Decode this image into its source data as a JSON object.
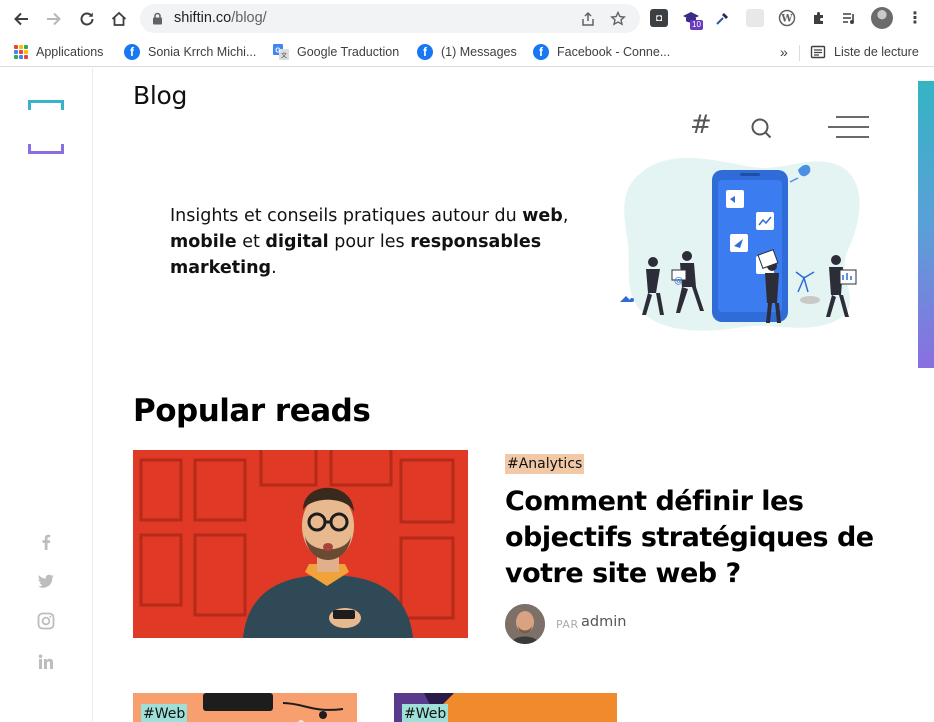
{
  "browser": {
    "url_host": "shiftin.co",
    "url_path": "/blog/",
    "extension_badge": "10",
    "bookmarks": [
      {
        "label": "Applications",
        "icon": "apps-grid-icon"
      },
      {
        "label": "Sonia Krrch Michi...",
        "icon": "facebook-icon"
      },
      {
        "label": "Google Traduction",
        "icon": "google-translate-icon"
      },
      {
        "label": "(1) Messages",
        "icon": "facebook-icon"
      },
      {
        "label": "Facebook - Conne...",
        "icon": "facebook-icon"
      }
    ],
    "more_bookmarks": "»",
    "reading_list": "Liste de lecture"
  },
  "site": {
    "page_title": "Blog",
    "header_hash": "#",
    "intro": {
      "part1": "Insights et conseils pratiques autour du ",
      "b1": "web",
      "part2": ",",
      "b2": "mobile",
      "part3": " et ",
      "b3": "digital",
      "part4": " pour les ",
      "b4": "responsables marketing",
      "part5": "."
    },
    "section_title": "Popular reads",
    "featured": {
      "tag": "#Analytics",
      "title": "Comment définir les objectifs stratégiques de votre site web ?",
      "by_label": "PAR",
      "author": "admin"
    },
    "cards": [
      {
        "tag": "#Web"
      },
      {
        "tag": "#Web"
      }
    ],
    "social": [
      "facebook-icon",
      "twitter-icon",
      "instagram-icon",
      "linkedin-icon"
    ]
  },
  "colors": {
    "accent_teal": "#34b4c3",
    "accent_purple": "#8a6fe0",
    "analytics_tag": "#f2c9a6",
    "web_tag": "#9ee0d8",
    "phone_blue": "#3b7df0"
  }
}
